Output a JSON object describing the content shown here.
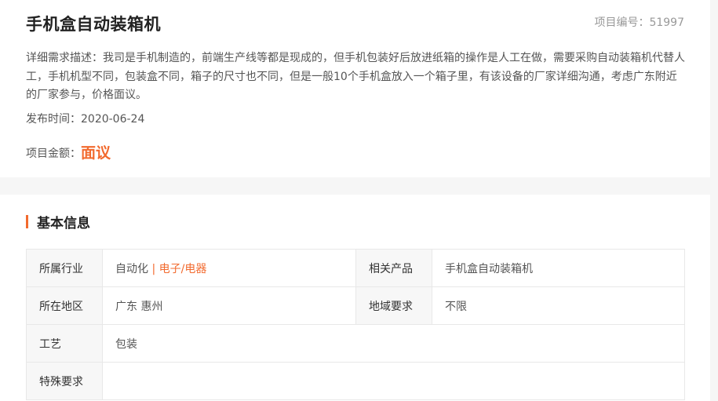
{
  "header": {
    "title": "手机盒自动装箱机",
    "project_no_label": "项目编号：",
    "project_no": "51997"
  },
  "description": {
    "label": "详细需求描述：",
    "text": "我司是手机制造的，前端生产线等都是现成的，但手机包装好后放进纸箱的操作是人工在做，需要采购自动装箱机代替人工，手机机型不同，包装盒不同，箱子的尺寸也不同，但是一般10个手机盒放入一个箱子里，有该设备的厂家详细沟通，考虑广东附近的厂家参与，价格面议。"
  },
  "publish": {
    "label": "发布时间：",
    "date": "2020-06-24"
  },
  "amount": {
    "label": "项目金额：",
    "value": "面议"
  },
  "basic_info": {
    "section_title": "基本信息",
    "industry_label": "所属行业",
    "industry_main": "自动化",
    "industry_sep": " | ",
    "industry_sub": "电子/电器",
    "product_label": "相关产品",
    "product_value": "手机盒自动装箱机",
    "region_label": "所在地区",
    "region_value": "广东 惠州",
    "region_req_label": "地域要求",
    "region_req_value": "不限",
    "process_label": "工艺",
    "process_value": "包装",
    "special_label": "特殊要求",
    "special_value": ""
  },
  "colors": {
    "accent": "#f26a2e",
    "muted": "#999999",
    "text": "#555555"
  }
}
